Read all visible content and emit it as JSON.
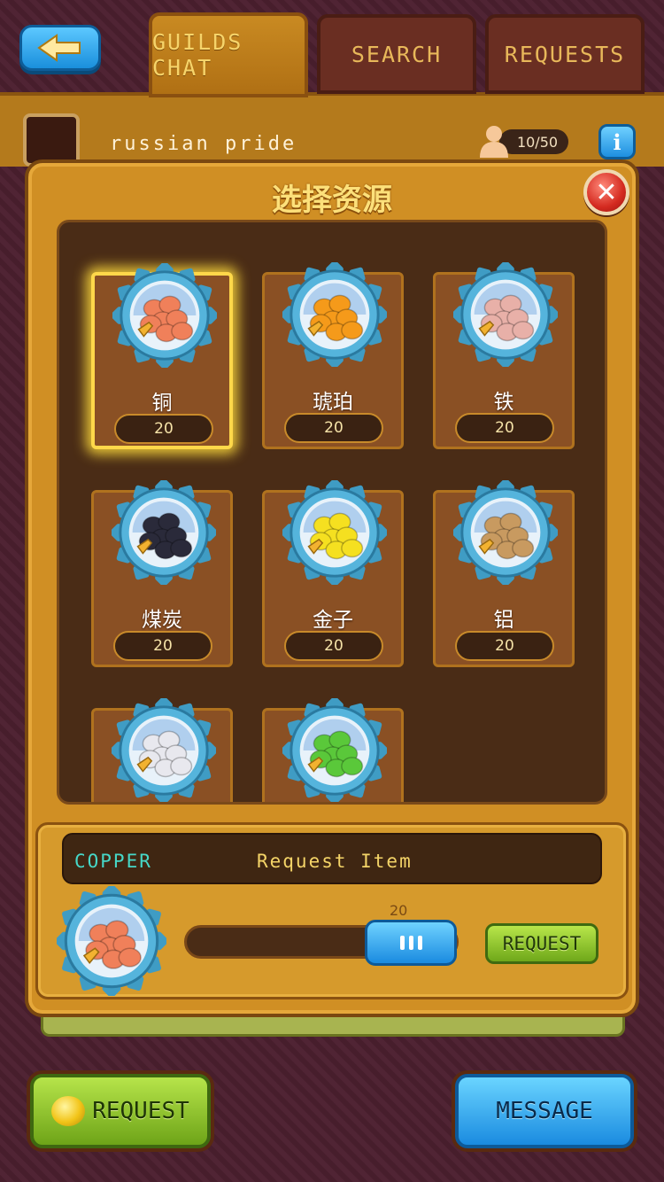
{
  "tabs": [
    {
      "label": "GUILDS CHAT",
      "active": true
    },
    {
      "label": "SEARCH",
      "active": false
    },
    {
      "label": "REQUESTS",
      "active": false
    }
  ],
  "guild": {
    "name": "russian pride",
    "members": "10/50"
  },
  "dialog": {
    "title": "选择资源",
    "resources": [
      {
        "label": "铜",
        "count": "20",
        "color": "#f0805a",
        "icon": "copper-ore-icon",
        "selected": true
      },
      {
        "label": "琥珀",
        "count": "20",
        "color": "#f59a1a",
        "icon": "amber-icon",
        "selected": false
      },
      {
        "label": "铁",
        "count": "20",
        "color": "#e8b0a8",
        "icon": "iron-ore-icon",
        "selected": false
      },
      {
        "label": "煤炭",
        "count": "20",
        "color": "#2a2a3a",
        "icon": "coal-icon",
        "selected": false
      },
      {
        "label": "金子",
        "count": "20",
        "color": "#f5e020",
        "icon": "gold-icon",
        "selected": false
      },
      {
        "label": "铝",
        "count": "20",
        "color": "#c89a60",
        "icon": "aluminum-icon",
        "selected": false
      },
      {
        "label": "",
        "count": "",
        "color": "#e8e8ee",
        "icon": "silver-ore-icon",
        "selected": false
      },
      {
        "label": "",
        "count": "",
        "color": "#5ac83a",
        "icon": "emerald-icon",
        "selected": false
      }
    ]
  },
  "request_panel": {
    "item_name": "COPPER",
    "title": "Request Item",
    "amount": "20",
    "amount_fraction": 0.66,
    "button": "REQUEST",
    "icon": "copper-ore-icon",
    "color": "#f0805a"
  },
  "bottom": {
    "request": "REQUEST",
    "message": "MESSAGE"
  }
}
